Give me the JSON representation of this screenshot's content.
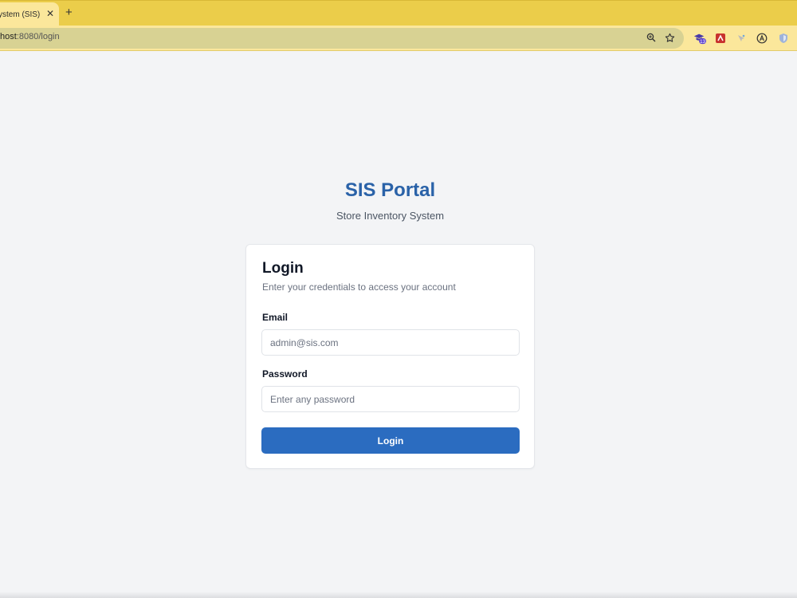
{
  "browser": {
    "tab_title": "ystem (SIS)",
    "tab_close": "✕",
    "new_tab": "+",
    "url_host": "host",
    "url_rest": ":8080/login",
    "extension_badge": "13",
    "icons": [
      "zoom-icon",
      "bookmark-star-icon",
      "extension-icon",
      "extension-icon",
      "extension-icon",
      "extension-icon",
      "extension-icon"
    ]
  },
  "header": {
    "title": "SIS Portal",
    "subtitle": "Store Inventory System"
  },
  "login": {
    "title": "Login",
    "description": "Enter your credentials to access your account",
    "email_label": "Email",
    "email_placeholder": "admin@sis.com",
    "password_label": "Password",
    "password_placeholder": "Enter any password",
    "submit_label": "Login"
  },
  "colors": {
    "brand": "#2a62a8",
    "button": "#2b6cc0",
    "page_bg": "#f3f4f6",
    "chrome_tabstrip": "#ebcd4a",
    "chrome_toolbar": "#fbe79b"
  }
}
